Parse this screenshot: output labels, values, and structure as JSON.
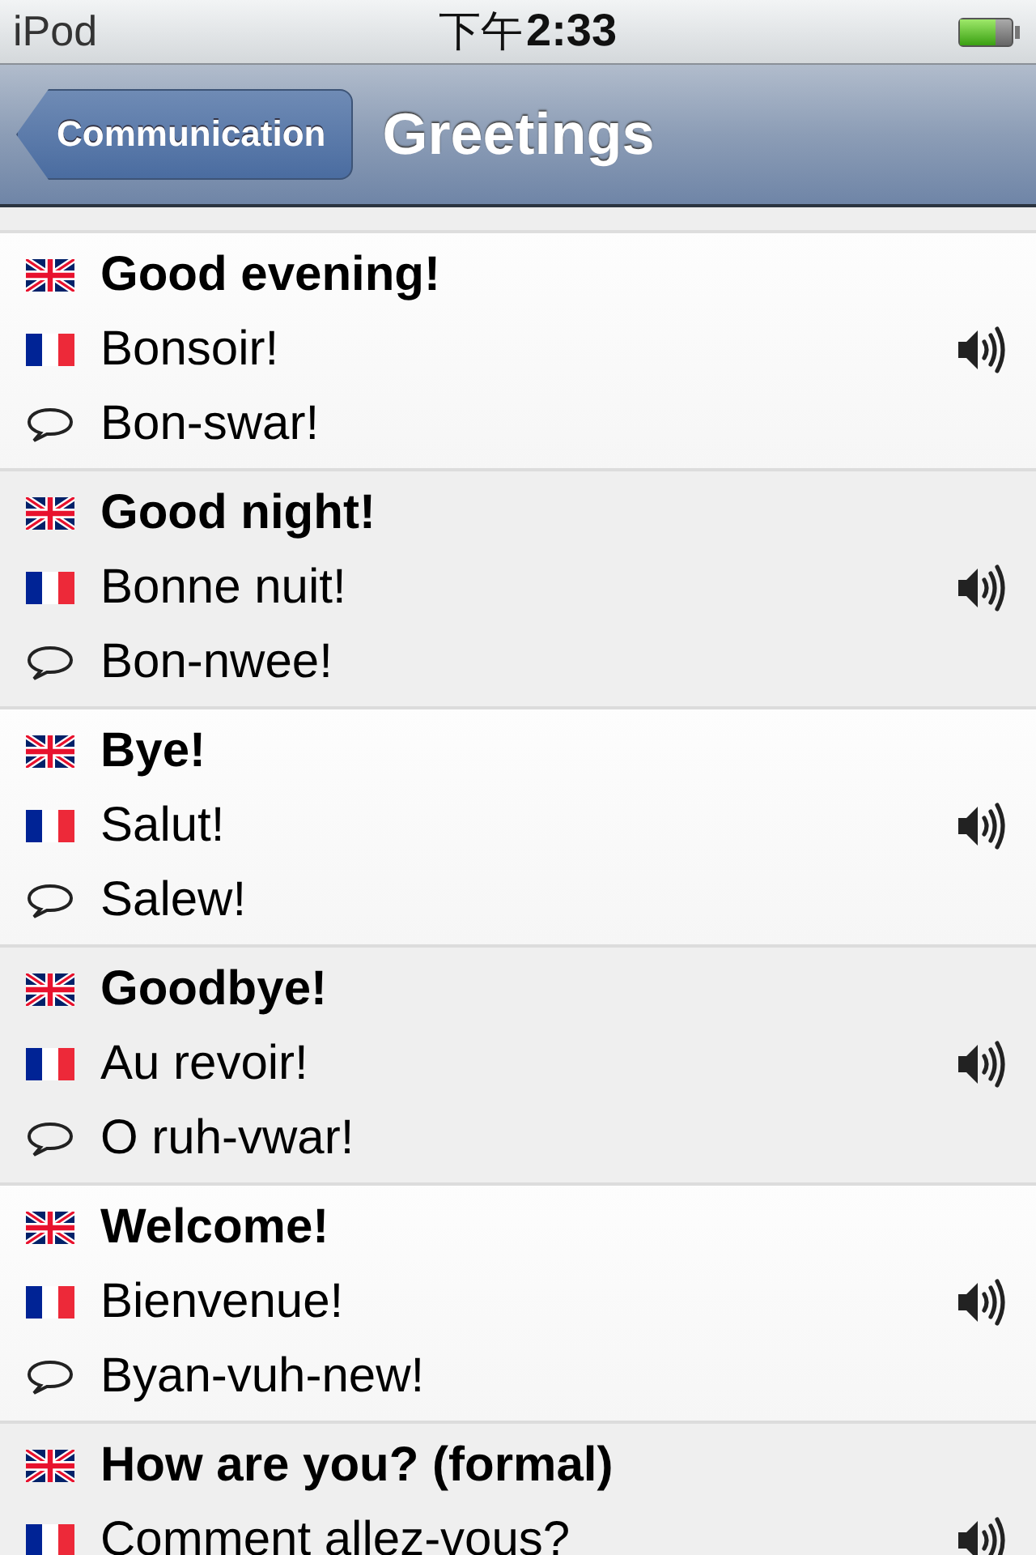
{
  "status_bar": {
    "carrier": "iPod",
    "time_prefix": "下午",
    "time": "2:33"
  },
  "nav_bar": {
    "back": "Communication",
    "title": "Greetings"
  },
  "phrases": [
    {
      "english": "Good evening!",
      "french": "Bonsoir!",
      "pronunciation": "Bon-swar!"
    },
    {
      "english": "Good night!",
      "french": "Bonne nuit!",
      "pronunciation": "Bon-nwee!"
    },
    {
      "english": "Bye!",
      "french": "Salut!",
      "pronunciation": "Salew!"
    },
    {
      "english": "Goodbye!",
      "french": "Au revoir!",
      "pronunciation": "O ruh-vwar!"
    },
    {
      "english": "Welcome!",
      "french": "Bienvenue!",
      "pronunciation": "Byan-vuh-new!"
    },
    {
      "english": "How are you? (formal)",
      "french": "Comment allez-vous?"
    }
  ]
}
